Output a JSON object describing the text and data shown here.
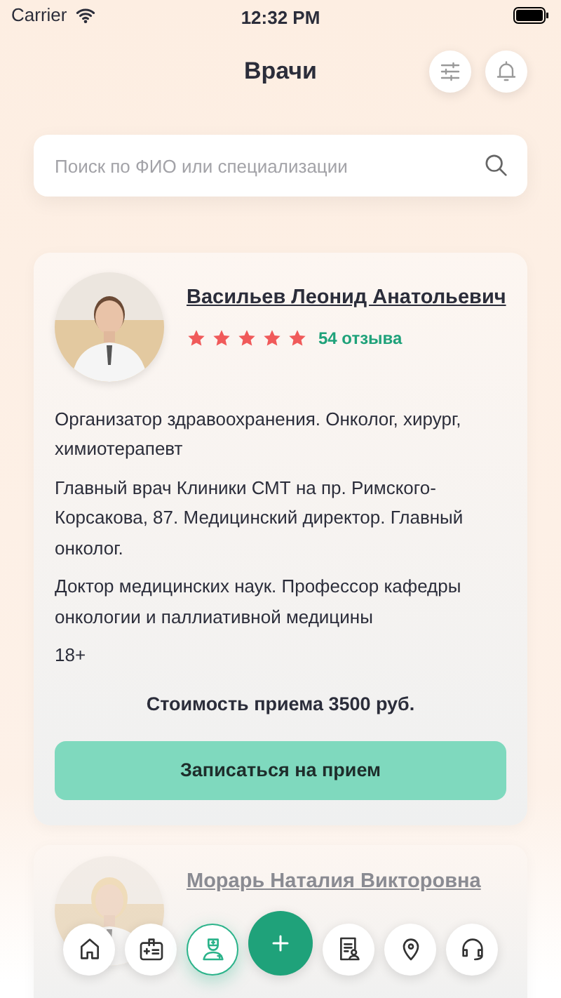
{
  "status_bar": {
    "carrier": "Carrier",
    "time": "12:32 PM"
  },
  "header": {
    "title": "Врачи"
  },
  "search": {
    "placeholder": "Поиск по ФИО или специализации"
  },
  "doctors": [
    {
      "name": "Васильев Леонид Анатольевич",
      "stars": 5,
      "reviews": "54 отзыва",
      "details": [
        "Организатор здравоохранения. Онколог, хирург, химиотерапевт",
        "Главный врач Клиники СМТ на пр. Римского-Корсакова, 87. Медицинский директор. Главный онколог.",
        "Доктор медицинских наук. Профессор кафедры онкологии и паллиативной медицины"
      ],
      "age": "18+",
      "price": "Стоимость приема 3500 руб.",
      "button": "Записаться на прием"
    },
    {
      "name": "Морарь Наталия Викторовна"
    }
  ],
  "nav": [
    {
      "kind": "home",
      "selected": false
    },
    {
      "kind": "card",
      "selected": false
    },
    {
      "kind": "doctor",
      "selected": true
    },
    {
      "kind": "plus",
      "selected": false
    },
    {
      "kind": "document",
      "selected": false
    },
    {
      "kind": "pin",
      "selected": false
    },
    {
      "kind": "support",
      "selected": false
    }
  ]
}
